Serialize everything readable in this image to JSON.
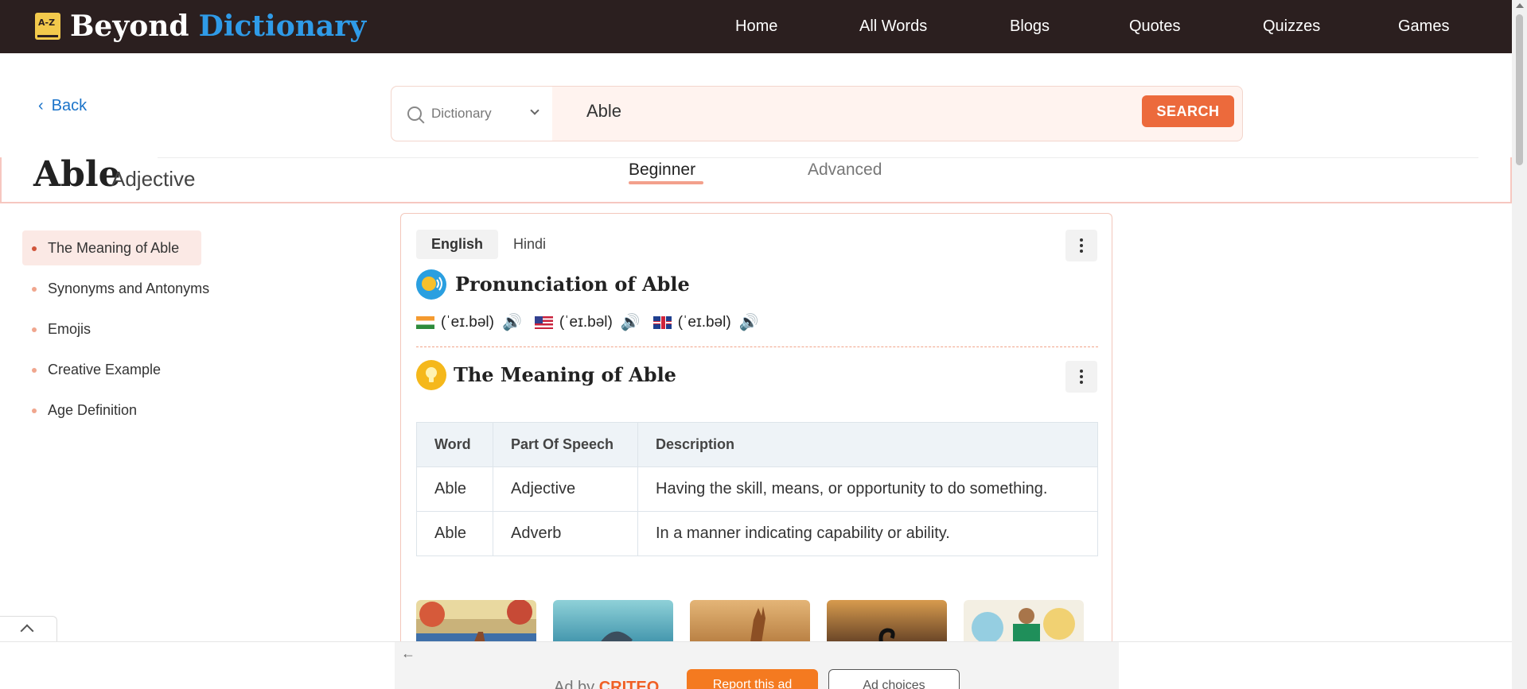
{
  "header": {
    "logo_badge": "A-Z",
    "logo_word1": "Beyond",
    "logo_word2": "Dictionary",
    "nav": [
      "Home",
      "All Words",
      "Blogs",
      "Quotes",
      "Quizzes",
      "Games"
    ]
  },
  "back_label": "Back",
  "search": {
    "category": "Dictionary",
    "value": "Able",
    "button_label": "SEARCH"
  },
  "word": {
    "title": "Able",
    "part_of_speech": "Adjective"
  },
  "level_tabs": {
    "beginner": "Beginner",
    "advanced": "Advanced",
    "active": "Beginner"
  },
  "sidebar": {
    "items": [
      {
        "label": "The Meaning of Able",
        "active": true
      },
      {
        "label": "Synonyms and Antonyms",
        "active": false
      },
      {
        "label": "Emojis",
        "active": false
      },
      {
        "label": "Creative Example",
        "active": false
      },
      {
        "label": "Age Definition",
        "active": false
      }
    ]
  },
  "card": {
    "lang_tabs": [
      "English",
      "Hindi"
    ],
    "active_lang": "English",
    "pronunciation": {
      "title": "Pronunciation of Able",
      "entries": [
        {
          "flag": "india-flag-icon",
          "ipa": "(ˈeɪ.bəl)"
        },
        {
          "flag": "us-flag-icon",
          "ipa": "(ˈeɪ.bəl)"
        },
        {
          "flag": "uk-flag-icon",
          "ipa": "(ˈeɪ.bəl)"
        }
      ]
    },
    "meaning": {
      "title": "The Meaning of Able",
      "columns": [
        "Word",
        "Part Of Speech",
        "Description"
      ],
      "rows": [
        [
          "Able",
          "Adjective",
          "Having the skill, means, or opportunity to do something."
        ],
        [
          "Able",
          "Adverb",
          "In a manner indicating capability or ability."
        ]
      ]
    }
  },
  "ad": {
    "by_label": "Ad by",
    "brand": "CRITEO",
    "report": "Report this ad",
    "choices": "Ad choices"
  },
  "colors": {
    "header_bg": "#2b1f1f",
    "brand_blue": "#2f9be8",
    "accent_orange": "#ec6a3c"
  }
}
